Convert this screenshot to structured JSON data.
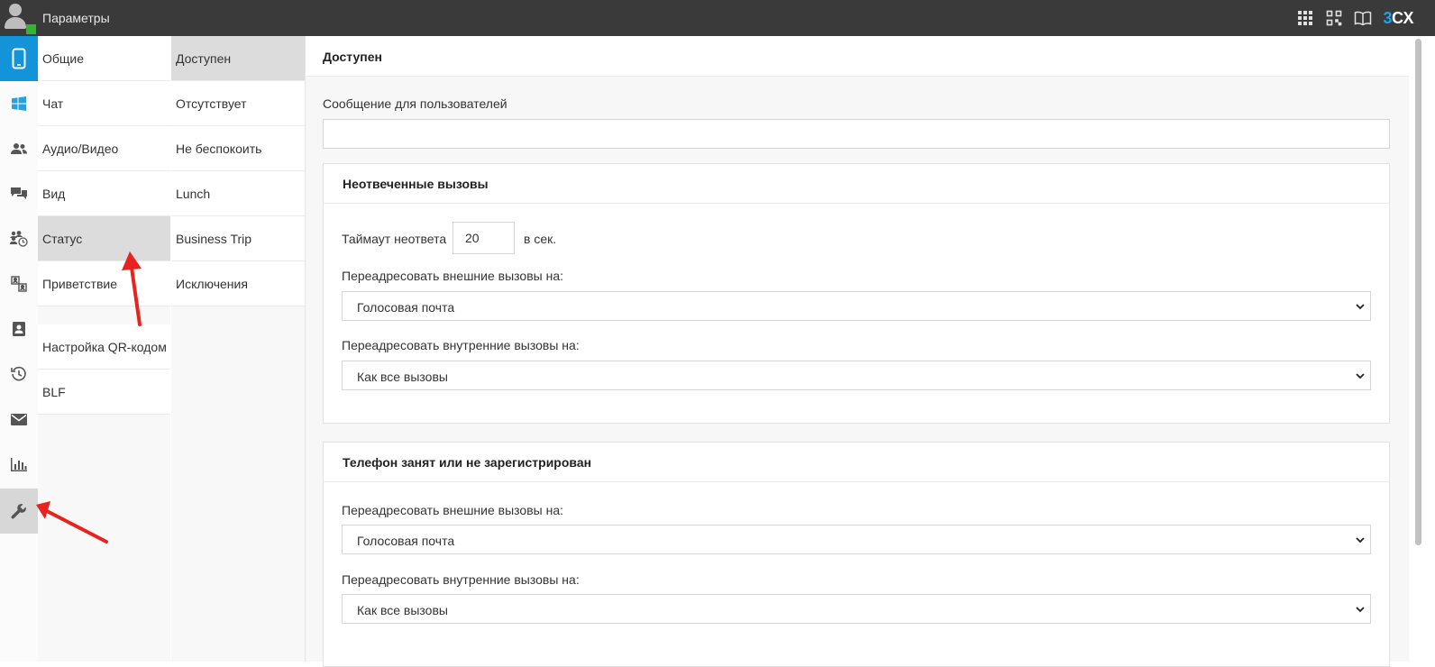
{
  "topbar": {
    "title": "Параметры",
    "logo_prefix": "3",
    "logo_suffix": "CX",
    "icons": [
      "apps-grid-icon",
      "qr-code-icon",
      "book-icon"
    ]
  },
  "rail": {
    "icons": [
      "phone-icon",
      "windows-icon",
      "people-icon",
      "chat-icon",
      "group-clock-icon",
      "contacts-switch-icon",
      "contact-card-icon",
      "history-icon",
      "mail-icon",
      "chart-icon",
      "wrench-icon"
    ],
    "active": "wrench-icon"
  },
  "menu1": {
    "items": [
      "Общие",
      "Чат",
      "Аудио/Видео",
      "Вид",
      "Статус",
      "Приветствие",
      "Настройка QR-кодом",
      "BLF"
    ],
    "selected": "Статус"
  },
  "menu2": {
    "items": [
      "Доступен",
      "Отсутствует",
      "Не беспокоить",
      "Lunch",
      "Business Trip",
      "Исключения"
    ],
    "selected": "Доступен"
  },
  "main": {
    "title": "Доступен",
    "message_label": "Сообщение для пользователей",
    "message_value": "",
    "unanswered": {
      "title": "Неотвеченные вызовы",
      "timeout_label": "Таймаут неответа",
      "timeout_value": "20",
      "timeout_unit": "в сек.",
      "external_label": "Переадресовать внешние вызовы на:",
      "external_value": "Голосовая почта",
      "internal_label": "Переадресовать внутренние вызовы на:",
      "internal_value": "Как все вызовы"
    },
    "busy": {
      "title": "Телефон занят или не зарегистрирован",
      "external_label": "Переадресовать внешние вызовы на:",
      "external_value": "Голосовая почта",
      "internal_label": "Переадресовать внутренние вызовы на:",
      "internal_value": "Как все вызовы"
    }
  },
  "colors": {
    "topbar": "#3a3a3a",
    "accent_blue": "#1393d8",
    "online_status": "#2fb52f",
    "annotation_arrow": "#e8231f"
  }
}
